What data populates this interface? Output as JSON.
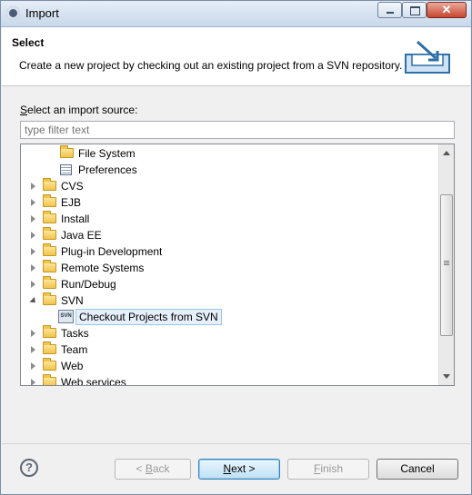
{
  "window": {
    "title": "Import"
  },
  "header": {
    "title": "Select",
    "description": "Create a new project by checking out an existing project from a SVN repository."
  },
  "source": {
    "label_mnemonic": "S",
    "label_rest": "elect an import source:",
    "filter_placeholder": "type filter text"
  },
  "tree": {
    "items": [
      {
        "label": "File System",
        "icon": "folder-icon"
      },
      {
        "label": "Preferences",
        "icon": "preferences-icon"
      },
      {
        "label": "CVS",
        "icon": "folder-icon",
        "state": "collapsed"
      },
      {
        "label": "EJB",
        "icon": "folder-icon",
        "state": "collapsed"
      },
      {
        "label": "Install",
        "icon": "folder-icon",
        "state": "collapsed"
      },
      {
        "label": "Java EE",
        "icon": "folder-icon",
        "state": "collapsed"
      },
      {
        "label": "Plug-in Development",
        "icon": "folder-icon",
        "state": "collapsed"
      },
      {
        "label": "Remote Systems",
        "icon": "folder-icon",
        "state": "collapsed"
      },
      {
        "label": "Run/Debug",
        "icon": "folder-icon",
        "state": "collapsed"
      },
      {
        "label": "SVN",
        "icon": "folder-icon",
        "state": "expanded"
      },
      {
        "label": "Checkout Projects from SVN",
        "icon": "svn-checkout-icon",
        "selected": true
      },
      {
        "label": "Tasks",
        "icon": "folder-icon",
        "state": "collapsed"
      },
      {
        "label": "Team",
        "icon": "folder-icon",
        "state": "collapsed"
      },
      {
        "label": "Web",
        "icon": "folder-icon",
        "state": "collapsed"
      },
      {
        "label": "Web services",
        "icon": "folder-icon",
        "state": "collapsed"
      }
    ],
    "svn_icon_text": "SVN"
  },
  "buttons": {
    "help": "?",
    "back_prefix": "< ",
    "back_mnemonic": "B",
    "back_rest": "ack",
    "next_mnemonic": "N",
    "next_rest": "ext >",
    "finish_mnemonic": "F",
    "finish_rest": "inish",
    "cancel": "Cancel"
  },
  "colors": {
    "selection": "#e6f0fb",
    "close_button": "#c8462e",
    "default_button_border": "#3c7fb1"
  }
}
